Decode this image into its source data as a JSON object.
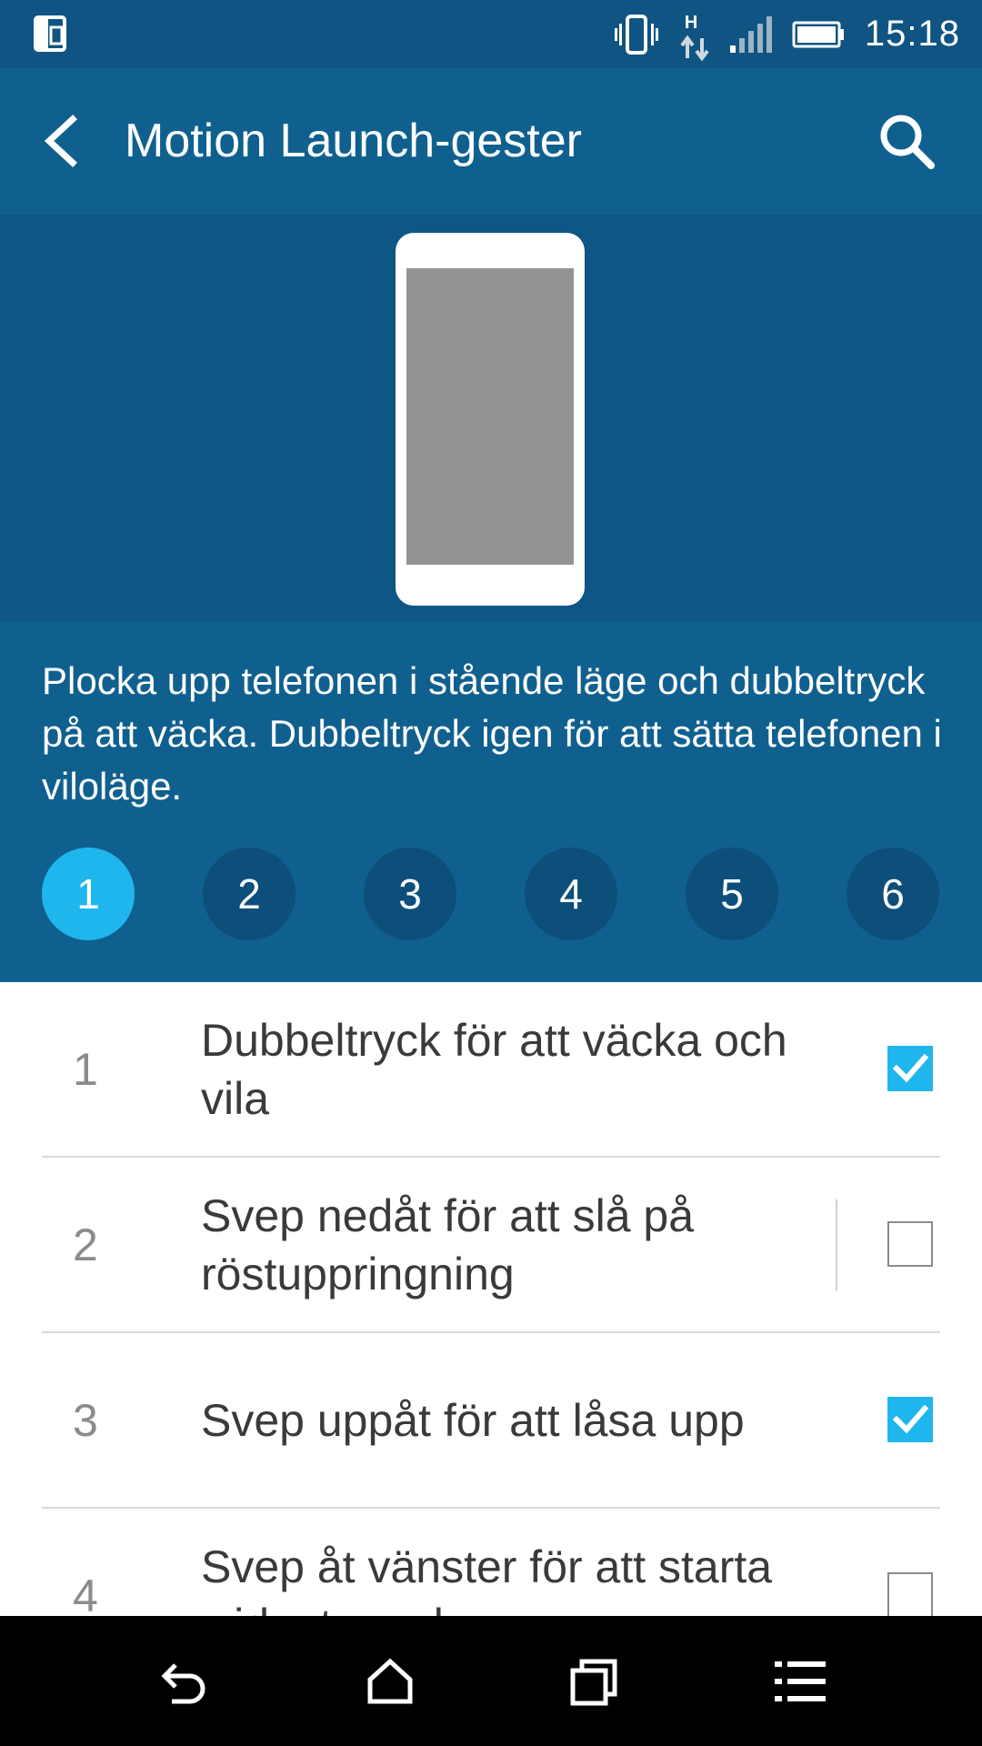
{
  "status_bar": {
    "time": "15:18",
    "network_type": "H",
    "icons": [
      "screen-mirror-icon",
      "vibrate-icon",
      "data-arrows-icon",
      "signal-icon",
      "battery-icon"
    ]
  },
  "header": {
    "title": "Motion Launch-gester",
    "back_icon": "back-arrow-icon",
    "search_icon": "search-icon"
  },
  "description": "Plocka upp telefonen i stående läge och dubbeltryck på att väcka. Dubbeltryck igen för att sätta telefonen i viloläge.",
  "steps": {
    "active": "1",
    "items": [
      "1",
      "2",
      "3",
      "4",
      "5",
      "6"
    ]
  },
  "gestures": [
    {
      "number": "1",
      "label": "Dubbeltryck för att väcka och vila",
      "checked": true
    },
    {
      "number": "2",
      "label": "Svep nedåt för att slå på röstuppringning",
      "checked": false
    },
    {
      "number": "3",
      "label": "Svep uppåt för att låsa upp",
      "checked": true
    },
    {
      "number": "4",
      "label": "Svep åt vänster för att starta widgetpanel",
      "checked": false
    }
  ],
  "nav_bar": {
    "icons": [
      "back-icon",
      "home-icon",
      "recent-apps-icon",
      "menu-icon"
    ]
  },
  "colors": {
    "status_bar": "#0f5482",
    "app_bar": "#10608f",
    "illustration_bg": "#0e5683",
    "accent": "#1fb6ee",
    "step_inactive": "#0d4e7a"
  }
}
